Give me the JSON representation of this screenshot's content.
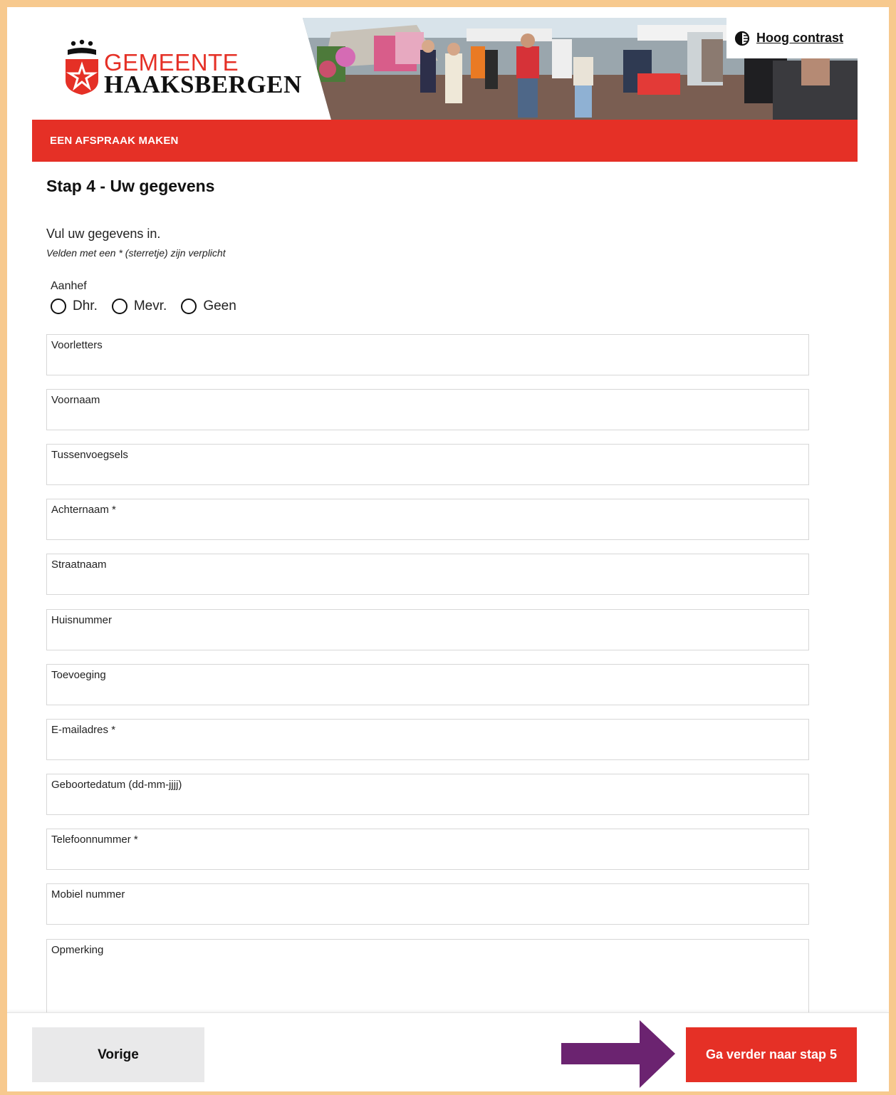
{
  "header": {
    "logo_line1": "GEMEENTE",
    "logo_line2": "HAAKSBERGEN",
    "contrast_label": "Hoog contrast"
  },
  "section_bar": {
    "title": "EEN AFSPRAAK MAKEN"
  },
  "form": {
    "step_title": "Stap 4 - Uw gegevens",
    "intro": "Vul uw gegevens in.",
    "required_note": "Velden met een * (sterretje) zijn verplicht",
    "salutation": {
      "label": "Aanhef",
      "options": [
        "Dhr.",
        "Mevr.",
        "Geen"
      ]
    },
    "fields": [
      {
        "label": "Voorletters",
        "value": ""
      },
      {
        "label": "Voornaam",
        "value": ""
      },
      {
        "label": "Tussenvoegsels",
        "value": ""
      },
      {
        "label": "Achternaam *",
        "value": ""
      },
      {
        "label": "Straatnaam",
        "value": ""
      },
      {
        "label": "Huisnummer",
        "value": ""
      },
      {
        "label": "Toevoeging",
        "value": ""
      },
      {
        "label": "E-mailadres *",
        "value": ""
      },
      {
        "label": "Geboortedatum (dd-mm-jjjj)",
        "value": ""
      },
      {
        "label": "Telefoonnummer *",
        "value": ""
      },
      {
        "label": "Mobiel nummer",
        "value": ""
      },
      {
        "label": "Opmerking",
        "value": ""
      }
    ]
  },
  "footer": {
    "prev_label": "Vorige",
    "next_label": "Ga verder naar stap 5"
  },
  "colors": {
    "brand_red": "#e53026",
    "page_border": "#f7c98e",
    "arrow": "#6b2370"
  },
  "icons": {
    "contrast": "contrast-icon",
    "logo": "crown-shield-icon",
    "arrow": "right-arrow-icon"
  }
}
